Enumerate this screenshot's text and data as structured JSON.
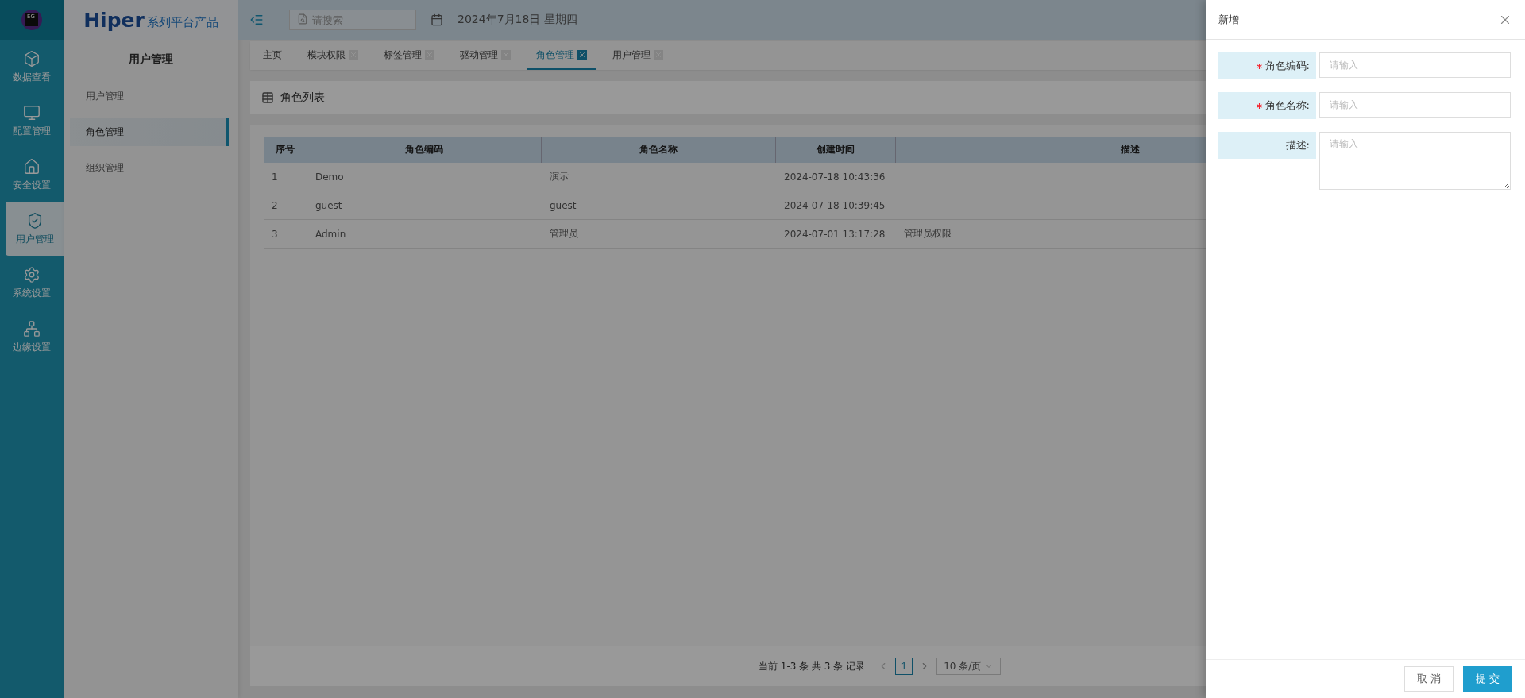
{
  "brand": {
    "app_icon_text": "EG",
    "logo_text": "Hiper",
    "tagline": "系列平台产品"
  },
  "rail": [
    {
      "label": "数据查看",
      "selected": false
    },
    {
      "label": "配置管理",
      "selected": false
    },
    {
      "label": "安全设置",
      "selected": false
    },
    {
      "label": "用户管理",
      "selected": true
    },
    {
      "label": "系统设置",
      "selected": false
    },
    {
      "label": "边缘设置",
      "selected": false
    }
  ],
  "sidebar": {
    "title": "用户管理",
    "items": [
      {
        "label": "用户管理",
        "selected": false
      },
      {
        "label": "角色管理",
        "selected": true
      },
      {
        "label": "组织管理",
        "selected": false
      }
    ]
  },
  "header": {
    "search_placeholder": "请搜索",
    "date": "2024年7月18日 星期四"
  },
  "tabs": [
    {
      "label": "主页",
      "selected": false,
      "closable": false
    },
    {
      "label": "模块权限",
      "selected": false,
      "closable": true
    },
    {
      "label": "标签管理",
      "selected": false,
      "closable": true
    },
    {
      "label": "驱动管理",
      "selected": false,
      "closable": true
    },
    {
      "label": "角色管理",
      "selected": true,
      "closable": true
    },
    {
      "label": "用户管理",
      "selected": false,
      "closable": true
    }
  ],
  "list_title": "角色列表",
  "table": {
    "columns": [
      "序号",
      "角色编码",
      "角色名称",
      "创建时间",
      "描述"
    ],
    "rows": [
      [
        "1",
        "Demo",
        "演示",
        "2024-07-18 10:43:36",
        ""
      ],
      [
        "2",
        "guest",
        "guest",
        "2024-07-18 10:39:45",
        ""
      ],
      [
        "3",
        "Admin",
        "管理员",
        "2024-07-01 13:17:28",
        "管理员权限"
      ]
    ]
  },
  "pagination": {
    "summary": "当前 1-3 条 共 3 条 记录",
    "page": "1",
    "page_size": "10 条/页"
  },
  "drawer": {
    "title": "新增",
    "fields": [
      {
        "label": "角色编码:",
        "required": true,
        "kind": "input",
        "placeholder": "请输入"
      },
      {
        "label": "角色名称:",
        "required": true,
        "kind": "input",
        "placeholder": "请输入"
      },
      {
        "label": "描述:",
        "required": false,
        "kind": "textarea",
        "placeholder": "请输入"
      }
    ],
    "buttons": [
      {
        "label": "取 消",
        "kind": "default"
      },
      {
        "label": "提 交",
        "kind": "primary"
      }
    ]
  }
}
